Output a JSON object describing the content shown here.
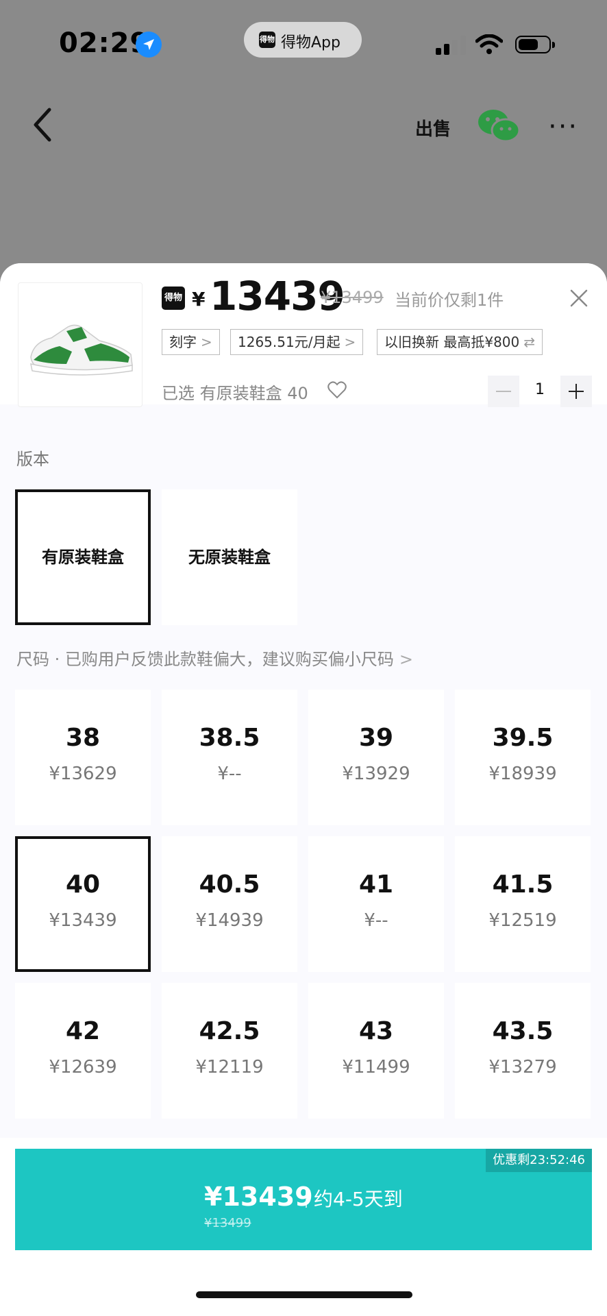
{
  "status_bar": {
    "time": "02:29",
    "app_name": "得物App",
    "app_logo_text": "得物"
  },
  "nav": {
    "sell_label": "出售"
  },
  "product": {
    "logo_text": "得物",
    "currency": "¥",
    "price": "13439",
    "original_price": "¥13499",
    "stock_note": "当前价仅剩1件",
    "chips": [
      {
        "label": "刻字"
      },
      {
        "label": "1265.51元/月起"
      },
      {
        "label": "以旧换新 最高抵¥800"
      }
    ],
    "selected_label": "已选 有原装鞋盒 40",
    "quantity": "1"
  },
  "version_section": {
    "title": "版本",
    "options": [
      {
        "label": "有原装鞋盒",
        "selected": true
      },
      {
        "label": "无原装鞋盒",
        "selected": false
      }
    ]
  },
  "size_section": {
    "title": "尺码 · 已购用户反馈此款鞋偏大，建议购买偏小尺码",
    "sizes": [
      {
        "size": "38",
        "price": "¥13629"
      },
      {
        "size": "38.5",
        "price": "¥--"
      },
      {
        "size": "39",
        "price": "¥13929"
      },
      {
        "size": "39.5",
        "price": "¥18939"
      },
      {
        "size": "40",
        "price": "¥13439",
        "selected": true
      },
      {
        "size": "40.5",
        "price": "¥14939"
      },
      {
        "size": "41",
        "price": "¥--"
      },
      {
        "size": "41.5",
        "price": "¥12519"
      },
      {
        "size": "42",
        "price": "¥12639"
      },
      {
        "size": "42.5",
        "price": "¥12119"
      },
      {
        "size": "43",
        "price": "¥11499"
      },
      {
        "size": "43.5",
        "price": "¥13279"
      }
    ]
  },
  "buy_button": {
    "promo": "优惠剩23:52:46",
    "price": "¥13439",
    "eta": "约4-5天到",
    "original_price": "¥13499"
  },
  "colors": {
    "accent": "#1dc6c2",
    "sneaker_green": "#2e8b3d"
  }
}
